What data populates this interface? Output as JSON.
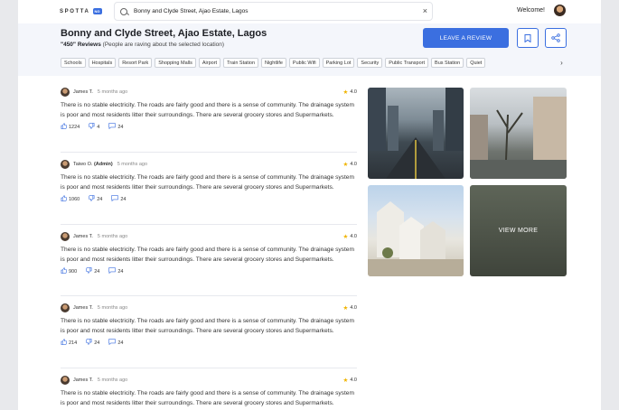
{
  "app": {
    "logo_text": "SPOTTA",
    "logo_badge": "NG"
  },
  "search": {
    "value": "Bonny and Clyde Street, Ajao Estate, Lagos",
    "clear_icon": "close-icon"
  },
  "user": {
    "welcome": "Welcome!"
  },
  "location": {
    "title": "Bonny and Clyde Street, Ajao Estate, Lagos",
    "reviews_count": "\"450\" Reviews",
    "reviews_caption": "(People are raving about the selected location)"
  },
  "actions": {
    "leave_review": "LEAVE A REVIEW",
    "bookmark_icon": "bookmark-icon",
    "share_icon": "share-icon"
  },
  "tags": [
    "Schools",
    "Hospitals",
    "Resort Park",
    "Shopping Malls",
    "Airport",
    "Train Station",
    "Nightlife",
    "Public Wifi",
    "Parking Lot",
    "Security",
    "Public Transport",
    "Bus Station",
    "Quiet"
  ],
  "reviews": [
    {
      "name": "James T.",
      "role": "",
      "time": "5 months ago",
      "rating": "4.0",
      "text": "There is no stable electricity. The roads are fairly good and there is a sense of community. The drainage system is poor and most residents litter their surroundings. There are several grocery stores and Supermarkets.",
      "likes": "1224",
      "dislikes": "4",
      "comments": "24"
    },
    {
      "name": "Taiwo O.",
      "role": "(Admin)",
      "time": "5 months ago",
      "rating": "4.0",
      "text": "There is no stable electricity. The roads are fairly good and there is a sense of community. The drainage system is poor and most residents litter their surroundings. There are several grocery stores and Supermarkets.",
      "likes": "1060",
      "dislikes": "24",
      "comments": "24"
    },
    {
      "name": "James T.",
      "role": "",
      "time": "5 months ago",
      "rating": "4.0",
      "text": "There is no stable electricity. The roads are fairly good and there is a sense of community. The drainage system is poor and most residents litter their surroundings. There are several grocery stores and Supermarkets.",
      "likes": "900",
      "dislikes": "24",
      "comments": "24"
    },
    {
      "name": "James T.",
      "role": "",
      "time": "5 months ago",
      "rating": "4.0",
      "text": "There is no stable electricity. The roads are fairly good and there is a sense of community. The drainage system is poor and most residents litter their surroundings. There are several grocery stores and Supermarkets.",
      "likes": "214",
      "dislikes": "24",
      "comments": "24"
    },
    {
      "name": "James T.",
      "role": "",
      "time": "5 months ago",
      "rating": "4.0",
      "text": "There is no stable electricity. The roads are fairly good and there is a sense of community. The drainage system is poor and most residents litter their surroundings. There are several grocery stores and Supermarkets.",
      "likes": "",
      "dislikes": "",
      "comments": ""
    }
  ],
  "gallery": {
    "view_more": "VIEW MORE"
  },
  "colors": {
    "accent": "#3b6fe0",
    "star": "#f0b400",
    "header_bg": "#f4f6fb"
  }
}
